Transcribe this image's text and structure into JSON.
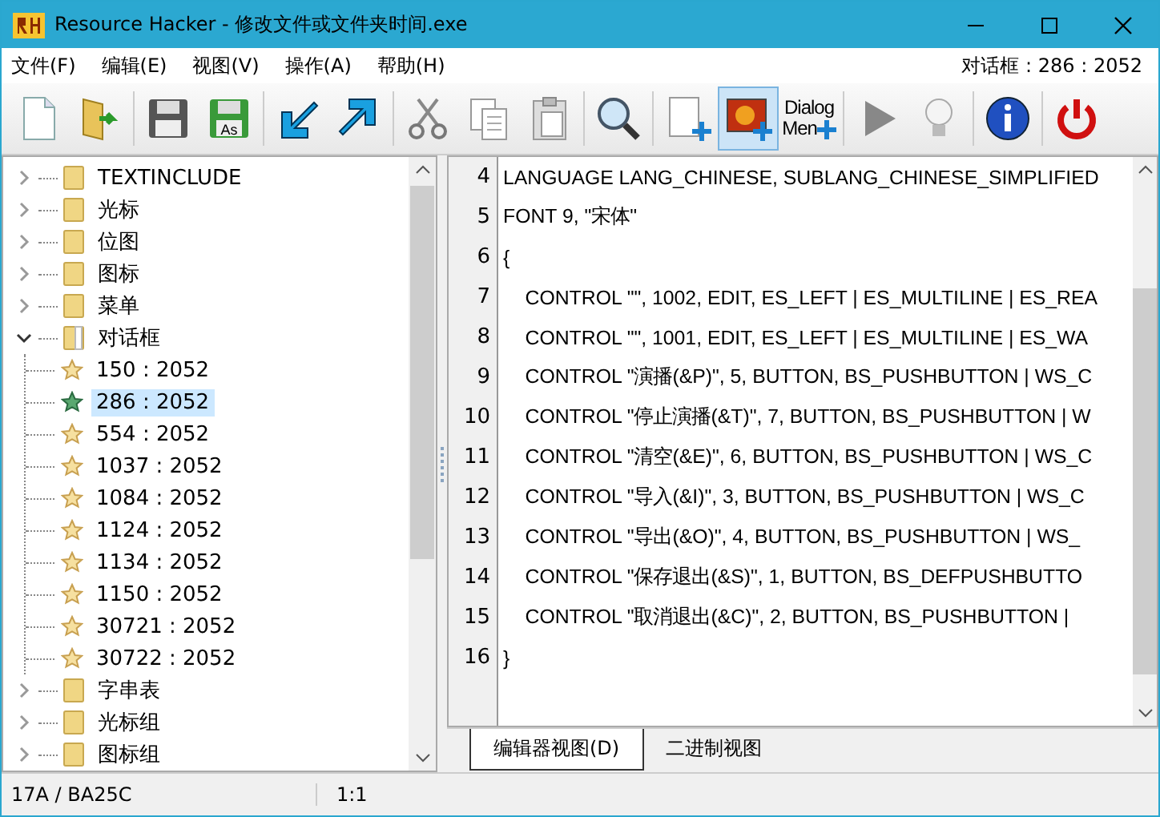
{
  "window": {
    "title": "Resource Hacker - 修改文件或文件夹时间.exe"
  },
  "menu": [
    "文件(F)",
    "编辑(E)",
    "视图(V)",
    "操作(A)",
    "帮助(H)"
  ],
  "current_resource": "对话框 : 286 : 2052",
  "toolbar": [
    {
      "kind": "new",
      "selected": false
    },
    {
      "kind": "open",
      "selected": false
    },
    {
      "kind": "separator"
    },
    {
      "kind": "save",
      "selected": false
    },
    {
      "kind": "saveas",
      "selected": false,
      "text": "As"
    },
    {
      "kind": "separator"
    },
    {
      "kind": "arrow-down",
      "selected": false
    },
    {
      "kind": "arrow-up",
      "selected": false
    },
    {
      "kind": "separator"
    },
    {
      "kind": "cut",
      "selected": false
    },
    {
      "kind": "copy",
      "selected": false
    },
    {
      "kind": "paste",
      "selected": false
    },
    {
      "kind": "separator"
    },
    {
      "kind": "find",
      "selected": false
    },
    {
      "kind": "separator"
    },
    {
      "kind": "add-blank",
      "selected": false
    },
    {
      "kind": "add-image",
      "selected": true
    },
    {
      "kind": "dialog-menu",
      "selected": false,
      "text": "Dialog",
      "text2": "Men"
    },
    {
      "kind": "separator"
    },
    {
      "kind": "play",
      "selected": false
    },
    {
      "kind": "bulb",
      "selected": false
    },
    {
      "kind": "separator"
    },
    {
      "kind": "info",
      "selected": false
    },
    {
      "kind": "separator"
    },
    {
      "kind": "power",
      "selected": false
    }
  ],
  "tree": [
    {
      "label": "TEXTINCLUDE",
      "expanded": false,
      "selected": false
    },
    {
      "label": "光标",
      "expanded": false,
      "selected": false
    },
    {
      "label": "位图",
      "expanded": false,
      "selected": false
    },
    {
      "label": "图标",
      "expanded": false,
      "selected": false
    },
    {
      "label": "菜单",
      "expanded": false,
      "selected": false
    },
    {
      "label": "对话框",
      "expanded": true,
      "selected": false,
      "children": [
        {
          "label": "150 : 2052",
          "selected": false
        },
        {
          "label": "286 : 2052",
          "selected": true
        },
        {
          "label": "554 : 2052",
          "selected": false
        },
        {
          "label": "1037 : 2052",
          "selected": false
        },
        {
          "label": "1084 : 2052",
          "selected": false
        },
        {
          "label": "1124 : 2052",
          "selected": false
        },
        {
          "label": "1134 : 2052",
          "selected": false
        },
        {
          "label": "1150 : 2052",
          "selected": false
        },
        {
          "label": "30721 : 2052",
          "selected": false
        },
        {
          "label": "30722 : 2052",
          "selected": false
        }
      ]
    },
    {
      "label": "字串表",
      "expanded": false,
      "selected": false
    },
    {
      "label": "光标组",
      "expanded": false,
      "selected": false
    },
    {
      "label": "图标组",
      "expanded": false,
      "selected": false
    }
  ],
  "code": [
    {
      "line": "4",
      "text": "LANGUAGE LANG_CHINESE, SUBLANG_CHINESE_SIMPLIFIED"
    },
    {
      "line": "5",
      "text": "FONT 9, \"宋体\""
    },
    {
      "line": "6",
      "text": "{"
    },
    {
      "line": "7",
      "text": "    CONTROL \"\", 1002, EDIT, ES_LEFT | ES_MULTILINE | ES_REA"
    },
    {
      "line": "8",
      "text": "    CONTROL \"\", 1001, EDIT, ES_LEFT | ES_MULTILINE | ES_WA"
    },
    {
      "line": "9",
      "text": "    CONTROL \"演播(&P)\", 5, BUTTON, BS_PUSHBUTTON | WS_C"
    },
    {
      "line": "10",
      "text": "    CONTROL \"停止演播(&T)\", 7, BUTTON, BS_PUSHBUTTON | W"
    },
    {
      "line": "11",
      "text": "    CONTROL \"清空(&E)\", 6, BUTTON, BS_PUSHBUTTON | WS_C"
    },
    {
      "line": "12",
      "text": "    CONTROL \"导入(&I)\", 3, BUTTON, BS_PUSHBUTTON | WS_C"
    },
    {
      "line": "13",
      "text": "    CONTROL \"导出(&O)\", 4, BUTTON, BS_PUSHBUTTON | WS_"
    },
    {
      "line": "14",
      "text": "    CONTROL \"保存退出(&S)\", 1, BUTTON, BS_DEFPUSHBUTTO"
    },
    {
      "line": "15",
      "text": "    CONTROL \"取消退出(&C)\", 2, BUTTON, BS_PUSHBUTTON |"
    },
    {
      "line": "16",
      "text": "}"
    }
  ],
  "view_tabs": [
    {
      "label": "编辑器视图(D)",
      "selected": true
    },
    {
      "label": "二进制视图",
      "selected": false
    }
  ],
  "status_bar": [
    "17A / BA25C",
    "1:1"
  ]
}
